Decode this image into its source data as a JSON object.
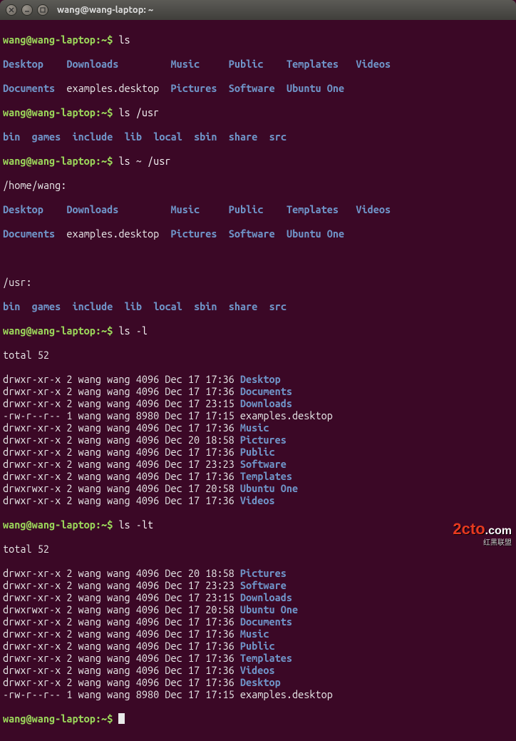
{
  "window": {
    "title": "wang@wang-laptop: ~"
  },
  "prompt": {
    "userhost": "wang@wang-laptop",
    "path": "~",
    "symbol": "$"
  },
  "cmds": {
    "ls": "ls",
    "ls_usr": "ls /usr",
    "ls_home_usr": "ls ~ /usr",
    "ls_l": "ls -l",
    "ls_lt": "ls -lt"
  },
  "home_header": "/home/wang:",
  "usr_header": "/usr:",
  "home_entries": {
    "Desktop": "Desktop",
    "Downloads": "Downloads",
    "Music": "Music",
    "Public": "Public",
    "Templates": "Templates",
    "Videos": "Videos",
    "Documents": "Documents",
    "examples": "examples.desktop",
    "Pictures": "Pictures",
    "Software": "Software",
    "UbuntuOne": "Ubuntu One"
  },
  "usr_entries": {
    "bin": "bin",
    "games": "games",
    "include": "include",
    "lib": "lib",
    "local": "local",
    "sbin": "sbin",
    "share": "share",
    "src": "src"
  },
  "totals": {
    "l": "total 52",
    "lt": "total 52"
  },
  "ls_l_rows": [
    {
      "perm": "drwxr-xr-x",
      "n": "2",
      "u": "wang",
      "g": "wang",
      "size": "4096",
      "date": "Dec 17 17:36",
      "name": "Desktop",
      "isdir": true
    },
    {
      "perm": "drwxr-xr-x",
      "n": "2",
      "u": "wang",
      "g": "wang",
      "size": "4096",
      "date": "Dec 17 17:36",
      "name": "Documents",
      "isdir": true
    },
    {
      "perm": "drwxr-xr-x",
      "n": "2",
      "u": "wang",
      "g": "wang",
      "size": "4096",
      "date": "Dec 17 23:15",
      "name": "Downloads",
      "isdir": true
    },
    {
      "perm": "-rw-r--r--",
      "n": "1",
      "u": "wang",
      "g": "wang",
      "size": "8980",
      "date": "Dec 17 17:15",
      "name": "examples.desktop",
      "isdir": false
    },
    {
      "perm": "drwxr-xr-x",
      "n": "2",
      "u": "wang",
      "g": "wang",
      "size": "4096",
      "date": "Dec 17 17:36",
      "name": "Music",
      "isdir": true
    },
    {
      "perm": "drwxr-xr-x",
      "n": "2",
      "u": "wang",
      "g": "wang",
      "size": "4096",
      "date": "Dec 20 18:58",
      "name": "Pictures",
      "isdir": true
    },
    {
      "perm": "drwxr-xr-x",
      "n": "2",
      "u": "wang",
      "g": "wang",
      "size": "4096",
      "date": "Dec 17 17:36",
      "name": "Public",
      "isdir": true
    },
    {
      "perm": "drwxr-xr-x",
      "n": "2",
      "u": "wang",
      "g": "wang",
      "size": "4096",
      "date": "Dec 17 23:23",
      "name": "Software",
      "isdir": true
    },
    {
      "perm": "drwxr-xr-x",
      "n": "2",
      "u": "wang",
      "g": "wang",
      "size": "4096",
      "date": "Dec 17 17:36",
      "name": "Templates",
      "isdir": true
    },
    {
      "perm": "drwxrwxr-x",
      "n": "2",
      "u": "wang",
      "g": "wang",
      "size": "4096",
      "date": "Dec 17 20:58",
      "name": "Ubuntu One",
      "isdir": true
    },
    {
      "perm": "drwxr-xr-x",
      "n": "2",
      "u": "wang",
      "g": "wang",
      "size": "4096",
      "date": "Dec 17 17:36",
      "name": "Videos",
      "isdir": true
    }
  ],
  "ls_lt_rows": [
    {
      "perm": "drwxr-xr-x",
      "n": "2",
      "u": "wang",
      "g": "wang",
      "size": "4096",
      "date": "Dec 20 18:58",
      "name": "Pictures",
      "isdir": true
    },
    {
      "perm": "drwxr-xr-x",
      "n": "2",
      "u": "wang",
      "g": "wang",
      "size": "4096",
      "date": "Dec 17 23:23",
      "name": "Software",
      "isdir": true
    },
    {
      "perm": "drwxr-xr-x",
      "n": "2",
      "u": "wang",
      "g": "wang",
      "size": "4096",
      "date": "Dec 17 23:15",
      "name": "Downloads",
      "isdir": true
    },
    {
      "perm": "drwxrwxr-x",
      "n": "2",
      "u": "wang",
      "g": "wang",
      "size": "4096",
      "date": "Dec 17 20:58",
      "name": "Ubuntu One",
      "isdir": true
    },
    {
      "perm": "drwxr-xr-x",
      "n": "2",
      "u": "wang",
      "g": "wang",
      "size": "4096",
      "date": "Dec 17 17:36",
      "name": "Documents",
      "isdir": true
    },
    {
      "perm": "drwxr-xr-x",
      "n": "2",
      "u": "wang",
      "g": "wang",
      "size": "4096",
      "date": "Dec 17 17:36",
      "name": "Music",
      "isdir": true
    },
    {
      "perm": "drwxr-xr-x",
      "n": "2",
      "u": "wang",
      "g": "wang",
      "size": "4096",
      "date": "Dec 17 17:36",
      "name": "Public",
      "isdir": true
    },
    {
      "perm": "drwxr-xr-x",
      "n": "2",
      "u": "wang",
      "g": "wang",
      "size": "4096",
      "date": "Dec 17 17:36",
      "name": "Templates",
      "isdir": true
    },
    {
      "perm": "drwxr-xr-x",
      "n": "2",
      "u": "wang",
      "g": "wang",
      "size": "4096",
      "date": "Dec 17 17:36",
      "name": "Videos",
      "isdir": true
    },
    {
      "perm": "drwxr-xr-x",
      "n": "2",
      "u": "wang",
      "g": "wang",
      "size": "4096",
      "date": "Dec 17 17:36",
      "name": "Desktop",
      "isdir": true
    },
    {
      "perm": "-rw-r--r--",
      "n": "1",
      "u": "wang",
      "g": "wang",
      "size": "8980",
      "date": "Dec 17 17:15",
      "name": "examples.desktop",
      "isdir": false
    }
  ],
  "watermark": {
    "main": "2cto",
    "dotcom": ".com",
    "sub": "红黑联盟"
  }
}
